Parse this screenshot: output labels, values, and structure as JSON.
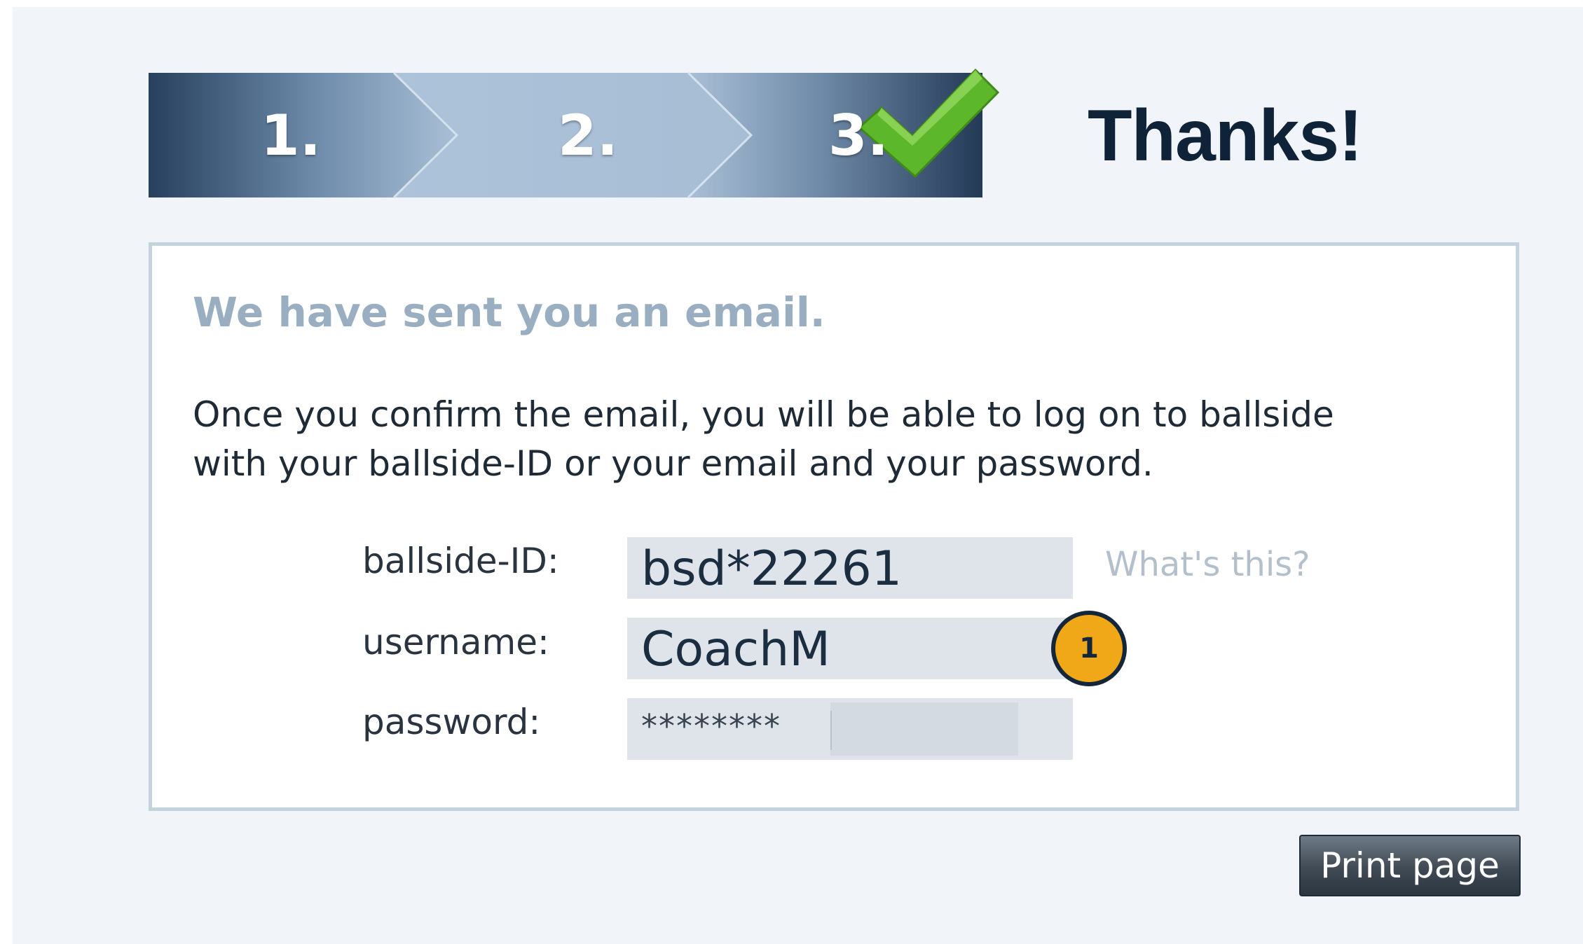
{
  "steps": {
    "items": [
      {
        "label": "1."
      },
      {
        "label": "2."
      },
      {
        "label": "3."
      }
    ],
    "completed_icon": "checkmark-icon",
    "title": "Thanks!"
  },
  "confirmation": {
    "heading": "We have sent you an email.",
    "message_lines": [
      "Once you confirm the email, you will be able to log on to ballside",
      "with your ballside-ID or your email and your password."
    ],
    "fields": {
      "ballside_id": {
        "label": "ballside-ID:",
        "value": "bsd*22261"
      },
      "username": {
        "label": "username:",
        "value": "CoachM"
      },
      "password": {
        "label": "password:",
        "value": "********"
      }
    },
    "whats_this_link": "What's this?"
  },
  "annotation_badge": {
    "number": "1"
  },
  "print_button_label": "Print page",
  "colors": {
    "page_background": "#f1f4f8",
    "box_border": "#c3d3e2",
    "heading_text": "#9aaec2",
    "badge_fill": "#f0a819",
    "badge_border": "#14263a",
    "checkmark": "#5cb82a"
  }
}
